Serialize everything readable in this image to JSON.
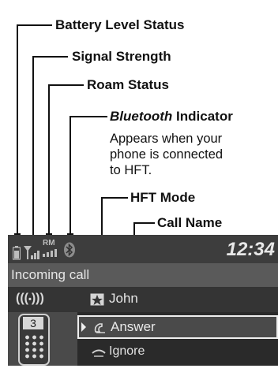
{
  "callouts": {
    "battery": "Battery Level Status",
    "signal": "Signal Strength",
    "roam": "Roam Status",
    "bluetooth_italic": "Bluetooth",
    "bluetooth_rest": " Indicator",
    "bluetooth_desc": [
      "Appears when your",
      "phone is connected",
      "to HFT."
    ],
    "hft_mode": "HFT Mode",
    "call_name": "Call Name"
  },
  "screen": {
    "roam_badge": "RM",
    "clock": "12:34",
    "incoming": "Incoming call",
    "caller": "John",
    "phone_number_slot": "3",
    "answer": "Answer",
    "ignore": "Ignore"
  },
  "icons": [
    "battery-icon",
    "signal-icon",
    "roam-icon",
    "bluetooth-icon",
    "hft-mode-icon",
    "ringing-icon",
    "contact-icon",
    "phone-keypad-icon",
    "answer-icon",
    "ignore-icon"
  ]
}
